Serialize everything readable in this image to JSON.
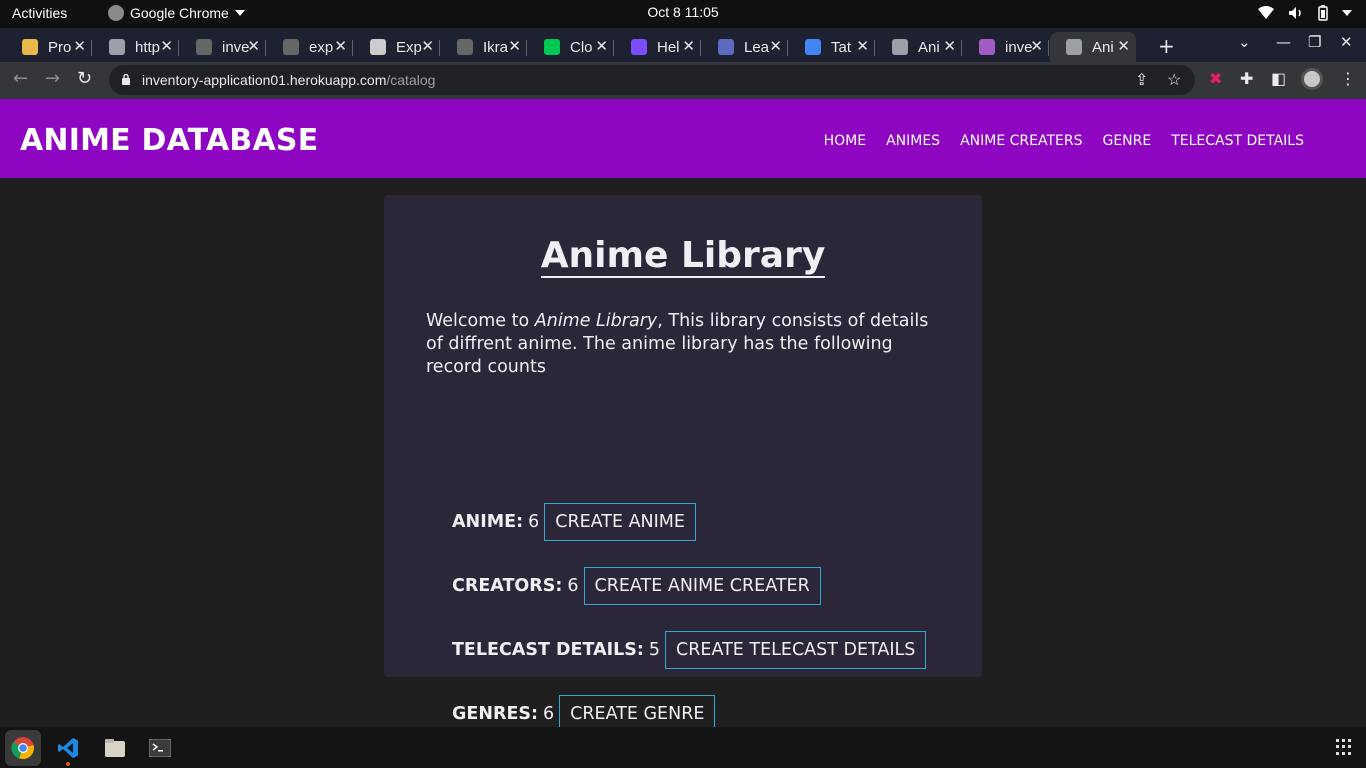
{
  "system": {
    "activities": "Activities",
    "app_name": "Google Chrome",
    "clock": "Oct 8  11:05"
  },
  "tabs": [
    {
      "title": "Pro",
      "color": "#e8b84a"
    },
    {
      "title": "http",
      "color": "#9aa0a6"
    },
    {
      "title": "inve",
      "color": "#666666"
    },
    {
      "title": "exp",
      "color": "#666666"
    },
    {
      "title": "Exp",
      "color": "#cccccc"
    },
    {
      "title": "Ikra",
      "color": "#666666"
    },
    {
      "title": "Clo",
      "color": "#00c853"
    },
    {
      "title": "Hel",
      "color": "#7c4dff"
    },
    {
      "title": "Lea",
      "color": "#5c6bc0"
    },
    {
      "title": "Tat",
      "color": "#4285f4"
    },
    {
      "title": "Ani",
      "color": "#9aa0a6"
    },
    {
      "title": "inve",
      "color": "#a15bc4"
    },
    {
      "title": "Ani",
      "color": "#9aa0a6",
      "active": true
    }
  ],
  "omnibox": {
    "host": "inventory-application01.herokuapp.com",
    "path": "/catalog"
  },
  "site": {
    "brand": "ANIME DATABASE",
    "nav": [
      "HOME",
      "ANIMES",
      "ANIME CREATERS",
      "GENRE",
      "TELECAST DETAILS"
    ],
    "accent": "#8e05c2"
  },
  "library": {
    "title": "Anime Library",
    "intro_before": "Welcome to ",
    "intro_em": "Anime Library",
    "intro_after": ", This library consists of details of diffrent anime. The anime library has the following record counts",
    "rows": [
      {
        "label": "ANIME:",
        "count": "6",
        "button": "CREATE ANIME"
      },
      {
        "label": "CREATORS:",
        "count": "6",
        "button": "CREATE ANIME CREATER"
      },
      {
        "label": "TELECAST DETAILS:",
        "count": "5",
        "button": "CREATE TELECAST DETAILS"
      },
      {
        "label": "GENRES:",
        "count": "6",
        "button": "CREATE GENRE"
      }
    ]
  },
  "dock": [
    "chrome-icon",
    "vscode-icon",
    "files-icon",
    "terminal-icon"
  ]
}
